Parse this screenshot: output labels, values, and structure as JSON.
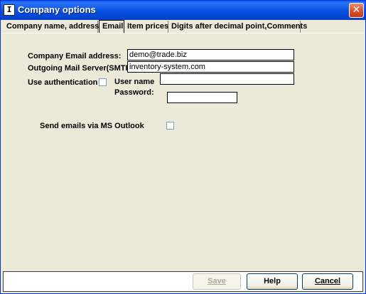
{
  "window": {
    "title": "Company options",
    "app_icon_glyph": "I",
    "close_glyph": "✕"
  },
  "tabs": [
    {
      "label": "Company name, address",
      "active": false
    },
    {
      "label": "Email",
      "active": true
    },
    {
      "label": "Item prices",
      "active": false
    },
    {
      "label": "Digits after decimal point,Comments",
      "active": false
    }
  ],
  "email_form": {
    "company_email_label": "Company Email address:",
    "company_email_value": "demo@trade.biz",
    "smtp_label": "Outgoing Mail Server(SMTP)",
    "smtp_value": "inventory-system.com",
    "use_auth_label": "Use authentication",
    "use_auth_checked": false,
    "username_label": "User name",
    "username_value": "",
    "password_label": "Password:",
    "password_value": "",
    "outlook_label": "Send emails via MS Outlook",
    "outlook_checked": false
  },
  "buttons": {
    "save_label": "Save",
    "help_label": "Help",
    "cancel_label": "Cancel"
  },
  "colors": {
    "titlebar": "#0b54e3",
    "face": "#ece9d8",
    "close": "#d44f2a"
  }
}
